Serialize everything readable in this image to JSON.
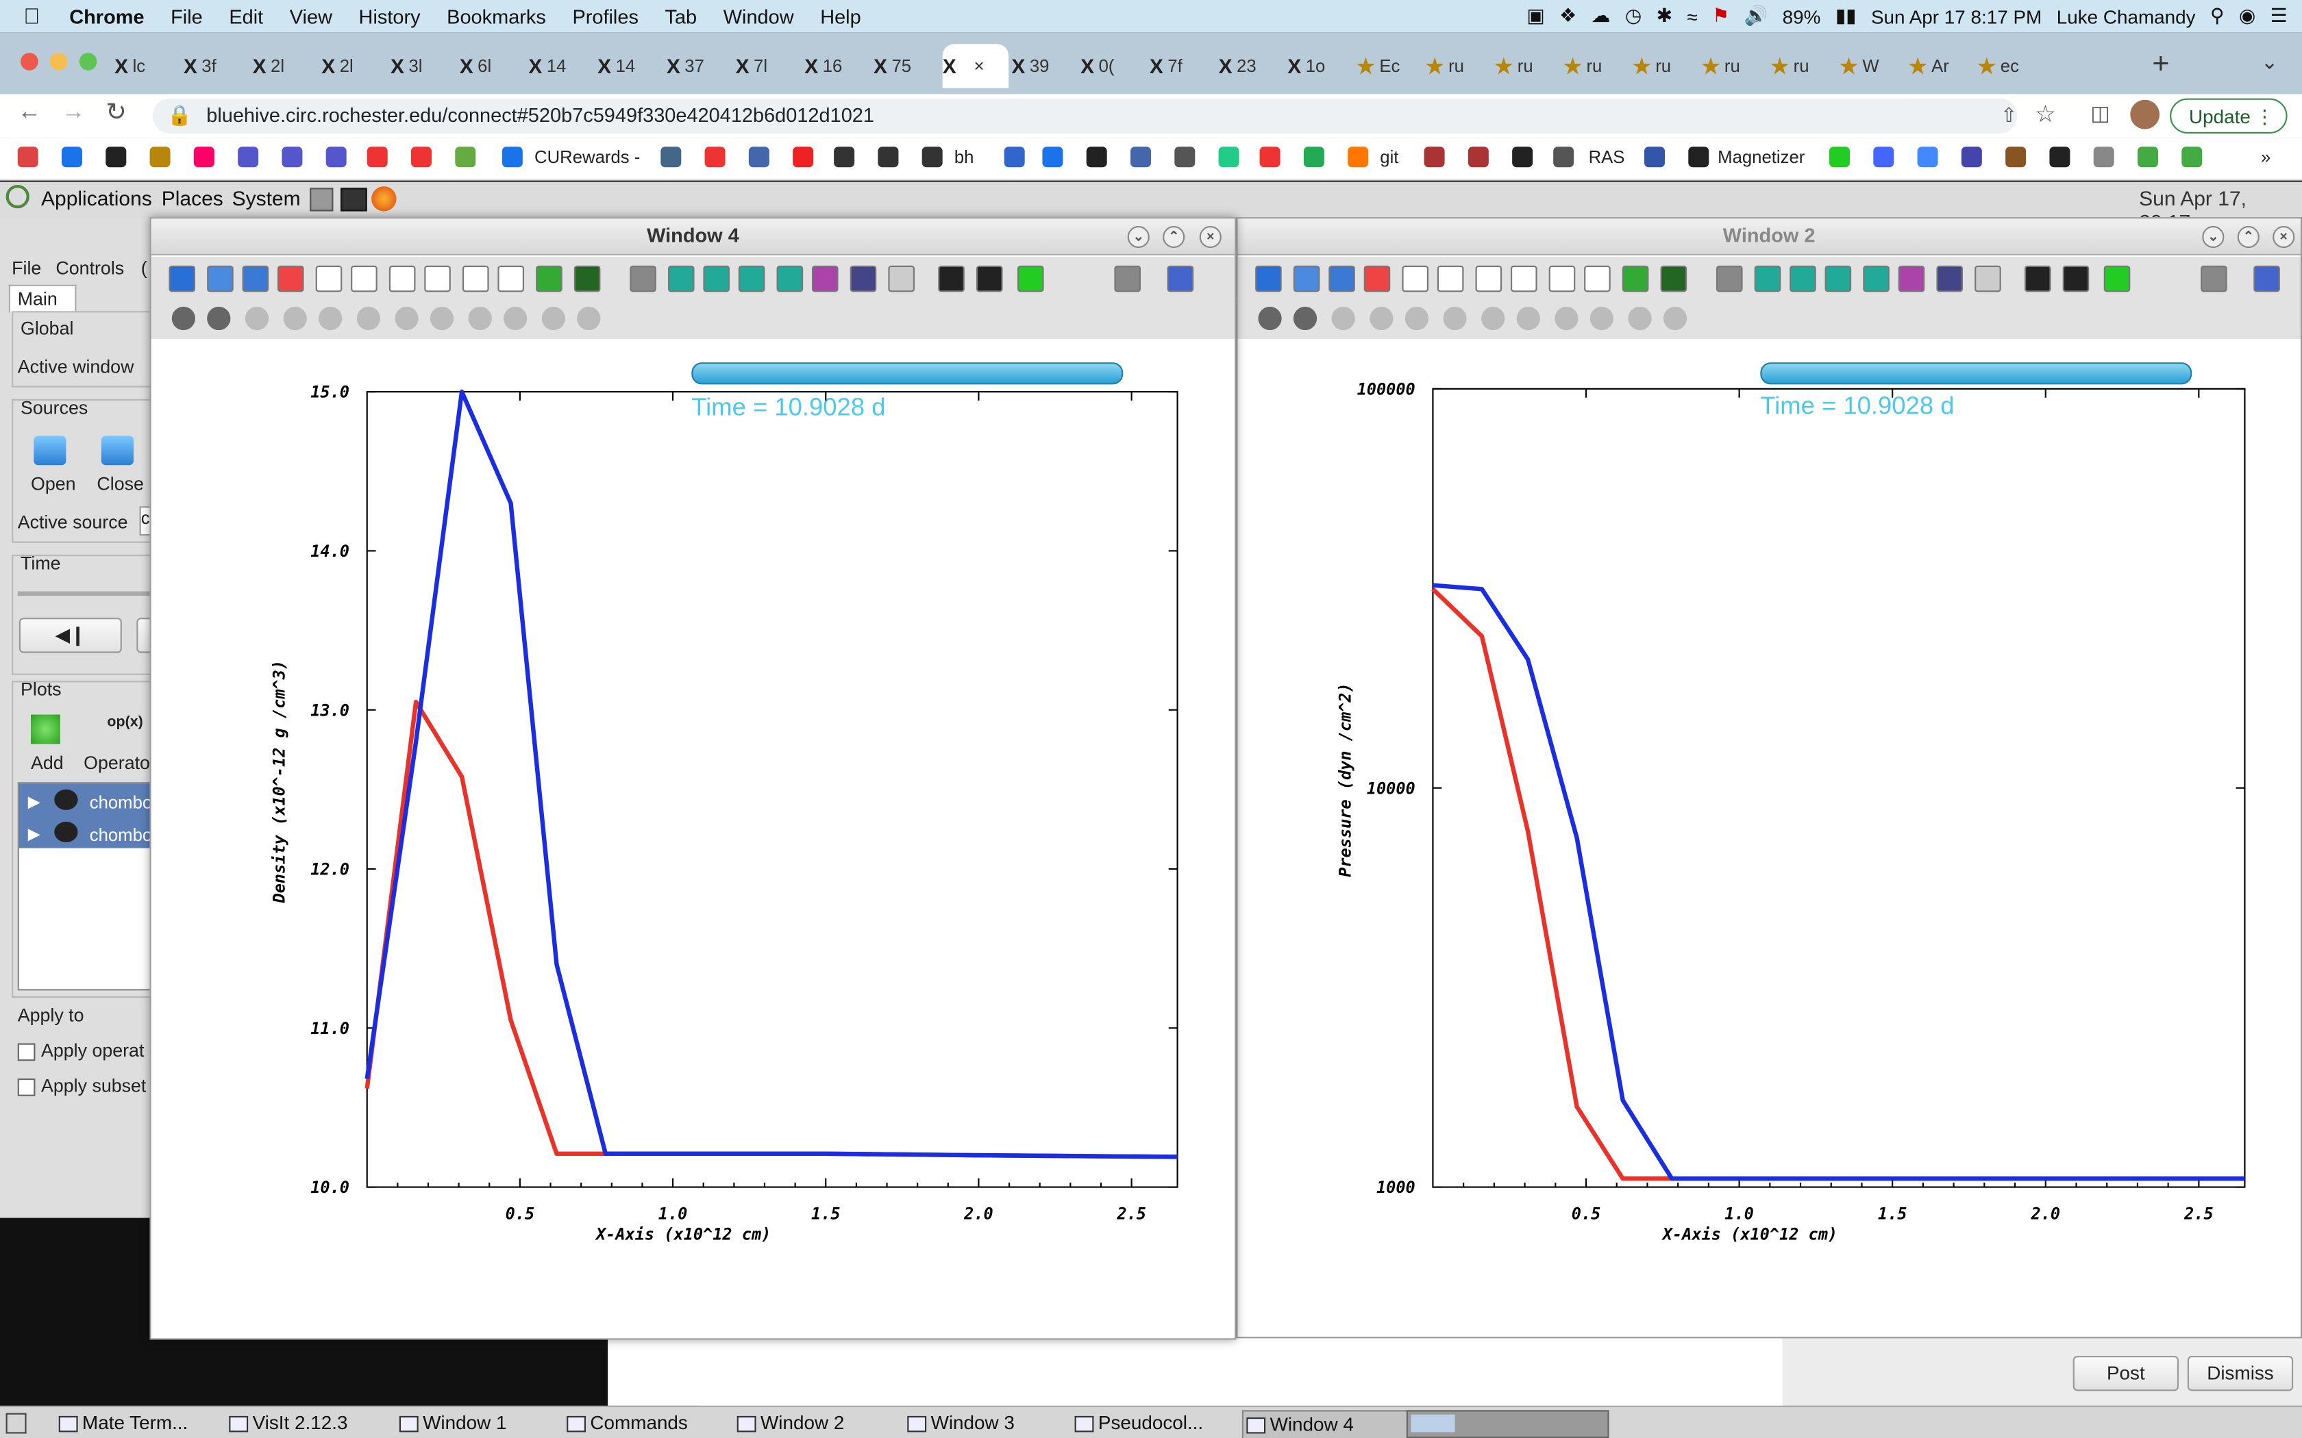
{
  "menubar": {
    "app": "Chrome",
    "items": [
      "File",
      "Edit",
      "View",
      "History",
      "Bookmarks",
      "Profiles",
      "Tab",
      "Window",
      "Help"
    ],
    "battery": "89%",
    "datetime": "Sun Apr 17  8:17 PM",
    "user": "Luke Chamandy"
  },
  "browser": {
    "url": "bluehive.circ.rochester.edu/connect#520b7c5949f330e420412b6d012d1021",
    "update_label": "Update",
    "tabs": [
      "lc",
      "3f",
      "2l",
      "2l",
      "3l",
      "6l",
      "14",
      "14",
      "37",
      "7l",
      "16",
      "75",
      "",
      "39",
      "0(",
      "7f",
      "23",
      "1o",
      "Ec",
      "ru",
      "ru",
      "ru",
      "ru",
      "ru",
      "ru",
      "W",
      "Ar",
      "ec"
    ],
    "bookmarks": {
      "curewards": "CURewards -",
      "bh": "bh",
      "git": "git",
      "ras": "RAS",
      "magnetizer": "Magnetizer"
    }
  },
  "desktop_panel": {
    "applications": "Applications",
    "places": "Places",
    "system": "System",
    "clock": "Sun Apr 17, 20:17"
  },
  "visit_panel": {
    "menu_file": "File",
    "menu_controls": "Controls",
    "menu_more": "(",
    "tab_main": "Main",
    "global": "Global",
    "active_window": "Active window",
    "sources": "Sources",
    "open": "Open",
    "close": "Close",
    "active_source": "Active source",
    "active_source_value": "c",
    "time": "Time",
    "plots": "Plots",
    "add": "Add",
    "operators_top": "op(x)",
    "operators": "Operato",
    "plot_items": [
      "chombo",
      "chombo"
    ],
    "apply_to": "Apply to",
    "apply_operators": "Apply operat",
    "apply_subset": "Apply subset"
  },
  "window4": {
    "title": "Window 4",
    "time_label": "Time = 10.9028 d"
  },
  "window2": {
    "title": "Window 2",
    "time_label": "Time = 10.9028 d"
  },
  "notification": {
    "post": "Post",
    "dismiss": "Dismiss"
  },
  "taskbar": {
    "items": [
      "Mate Term...",
      "VisIt 2.12.3",
      "Window 1",
      "Commands",
      "Window 2",
      "Window 3",
      "Pseudocol...",
      "Window 4"
    ]
  },
  "chart_data": [
    {
      "type": "line",
      "window": "Window 4",
      "xlabel": "X-Axis (x10^12 cm)",
      "ylabel": "Density (x10^-12 g /cm^3)",
      "xlim": [
        0.0,
        2.65
      ],
      "ylim": [
        10.0,
        15.0
      ],
      "x_ticks": [
        0.5,
        1.0,
        1.5,
        2.0,
        2.5
      ],
      "x_tick_labels": [
        "0.5",
        "1.0",
        "1.5",
        "2.0",
        "2.5"
      ],
      "y_ticks": [
        10.0,
        11.0,
        12.0,
        13.0,
        14.0,
        15.0
      ],
      "y_tick_labels": [
        "10.0",
        "11.0",
        "12.0",
        "13.0",
        "14.0",
        "15.0"
      ],
      "series": [
        {
          "color": "#e8332a",
          "x": [
            0.0,
            0.16,
            0.31,
            0.47,
            0.62,
            0.78,
            1.5,
            2.0,
            2.65
          ],
          "y": [
            10.62,
            13.05,
            12.58,
            11.05,
            10.21,
            10.21,
            10.21,
            10.2,
            10.19
          ]
        },
        {
          "color": "#1a2ee0",
          "x": [
            0.0,
            0.16,
            0.31,
            0.47,
            0.62,
            0.78,
            1.5,
            2.0,
            2.65
          ],
          "y": [
            10.68,
            12.8,
            15.0,
            14.3,
            11.4,
            10.21,
            10.21,
            10.2,
            10.19
          ]
        }
      ]
    },
    {
      "type": "line",
      "window": "Window 2",
      "xlabel": "X-Axis (x10^12 cm)",
      "ylabel": "Pressure (dyn /cm^2)",
      "xlim": [
        0.0,
        2.65
      ],
      "ylim": [
        1000,
        100000
      ],
      "y_scale": "log",
      "x_ticks": [
        0.5,
        1.0,
        1.5,
        2.0,
        2.5
      ],
      "x_tick_labels": [
        "0.5",
        "1.0",
        "1.5",
        "2.0",
        "2.5"
      ],
      "y_ticks": [
        1000,
        10000,
        100000
      ],
      "y_tick_labels": [
        "1000",
        "10000",
        "100000"
      ],
      "series": [
        {
          "color": "#e8332a",
          "x": [
            0.0,
            0.16,
            0.31,
            0.47,
            0.62,
            0.78,
            2.65
          ],
          "y": [
            31500,
            24000,
            7800,
            1590,
            1050,
            1050,
            1050
          ]
        },
        {
          "color": "#1a2ee0",
          "x": [
            0.0,
            0.16,
            0.31,
            0.47,
            0.62,
            0.78,
            2.65
          ],
          "y": [
            32200,
            31500,
            21000,
            7500,
            1650,
            1050,
            1050
          ]
        }
      ]
    }
  ]
}
